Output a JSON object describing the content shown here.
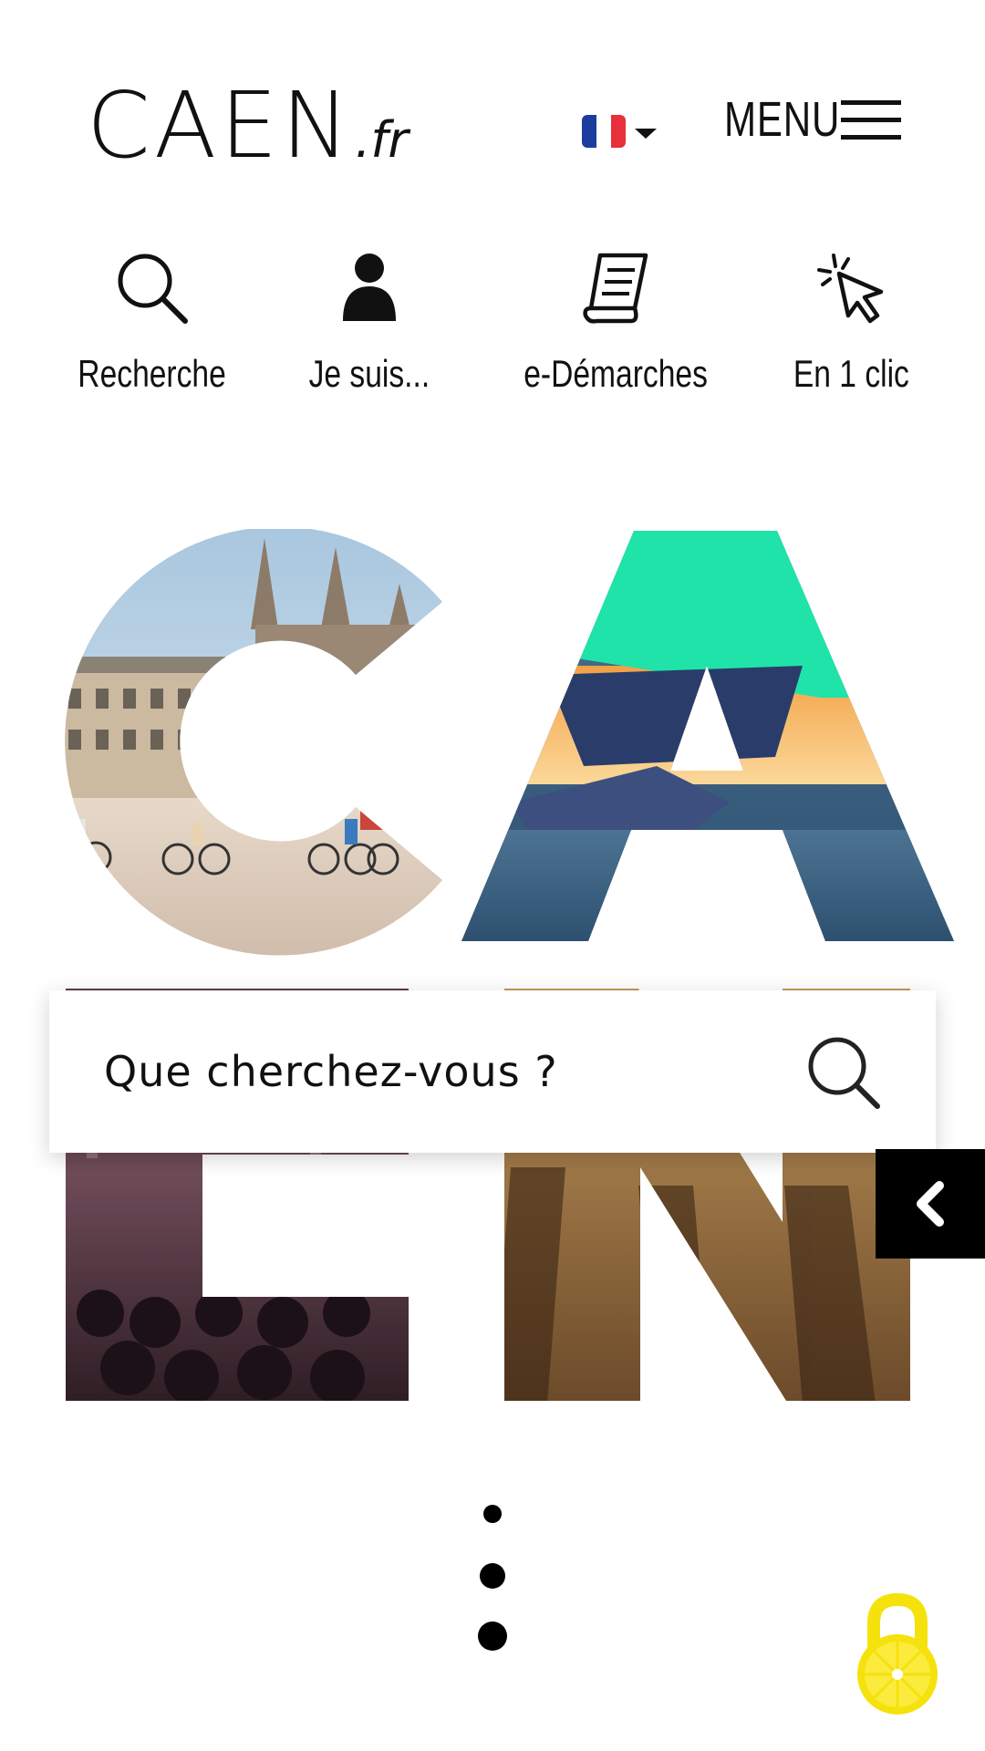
{
  "header": {
    "logo_main": "CAEN",
    "logo_tld": ".fr",
    "menu_label": "MENU"
  },
  "language": {
    "icon": "france-flag-icon",
    "flag_colors": [
      "#1d3d9e",
      "#ffffff",
      "#e8303a"
    ]
  },
  "quick_links": [
    {
      "label": "Recherche",
      "icon": "search-icon"
    },
    {
      "label": "Je suis...",
      "icon": "user-icon"
    },
    {
      "label": "e-Démarches",
      "icon": "document-scroll-icon"
    },
    {
      "label": "En 1 clic",
      "icon": "cursor-click-icon"
    }
  ],
  "hero": {
    "letters": [
      "C",
      "A",
      "E",
      "N"
    ],
    "accent_color": "#1fe3a8"
  },
  "search": {
    "placeholder": "Que cherchez-vous ?"
  },
  "carousel": {
    "arrow_icon": "chevron-left-icon"
  },
  "accessibility": {
    "icon": "lemon-padlock-icon",
    "color": "#f5e20c"
  }
}
